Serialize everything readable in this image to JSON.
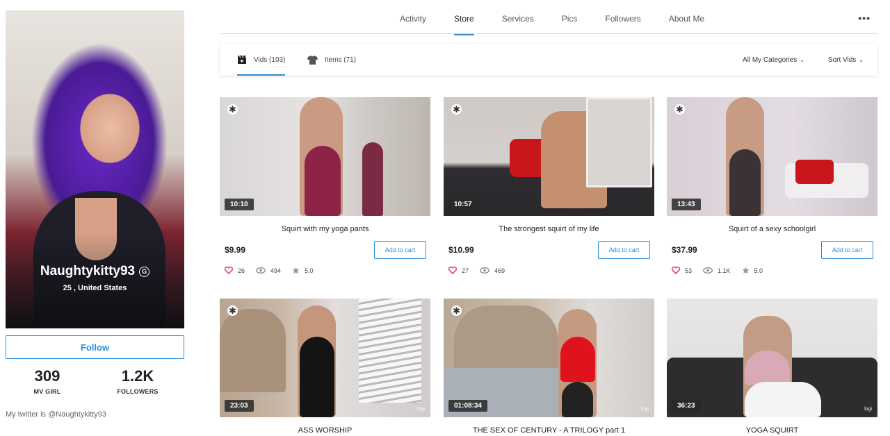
{
  "profile": {
    "name": "Naughtykitty93",
    "badge": "G",
    "meta": "25 , United States",
    "follow_label": "Follow",
    "stats": [
      {
        "value": "309",
        "label": "MV GIRL"
      },
      {
        "value": "1.2K",
        "label": "FOLLOWERS"
      }
    ],
    "bio": "My twitter is @Naughtykitty93"
  },
  "nav": {
    "tabs": [
      "Activity",
      "Store",
      "Services",
      "Pics",
      "Followers",
      "About Me"
    ],
    "active": "Store",
    "more_icon": "•••"
  },
  "store": {
    "vids_label": "Vids (103)",
    "items_label": "Items (71)",
    "categories_label": "All My Categories",
    "sort_label": "Sort Vids"
  },
  "videos": [
    {
      "title": "Squirt with my yoga pants",
      "duration": "10:10",
      "price": "$9.99",
      "cart_label": "Add to cart",
      "likes": "26",
      "views": "494",
      "rating": "5.0",
      "badge": "✱",
      "watermark": ""
    },
    {
      "title": "The strongest squirt of my life",
      "duration": "10:57",
      "price": "$10.99",
      "cart_label": "Add to cart",
      "likes": "27",
      "views": "469",
      "rating": "",
      "badge": "✱",
      "watermark": ""
    },
    {
      "title": "Squirt of a sexy schoolgirl",
      "duration": "13:43",
      "price": "$37.99",
      "cart_label": "Add to cart",
      "likes": "53",
      "views": "1.1K",
      "rating": "5.0",
      "badge": "✱",
      "watermark": ""
    },
    {
      "title": "ASS WORSHIP",
      "duration": "23:03",
      "badge": "✱",
      "watermark": "logi"
    },
    {
      "title": "THE SEX OF CENTURY - A TRILOGY part 1",
      "duration": "01:08:34",
      "badge": "✱",
      "watermark": "logi"
    },
    {
      "title": "YOGA SQUIRT",
      "duration": "36:23",
      "badge": "",
      "watermark": "logi"
    }
  ],
  "colors": {
    "accent": "#2b8ed8",
    "heart": "#e8456b"
  }
}
